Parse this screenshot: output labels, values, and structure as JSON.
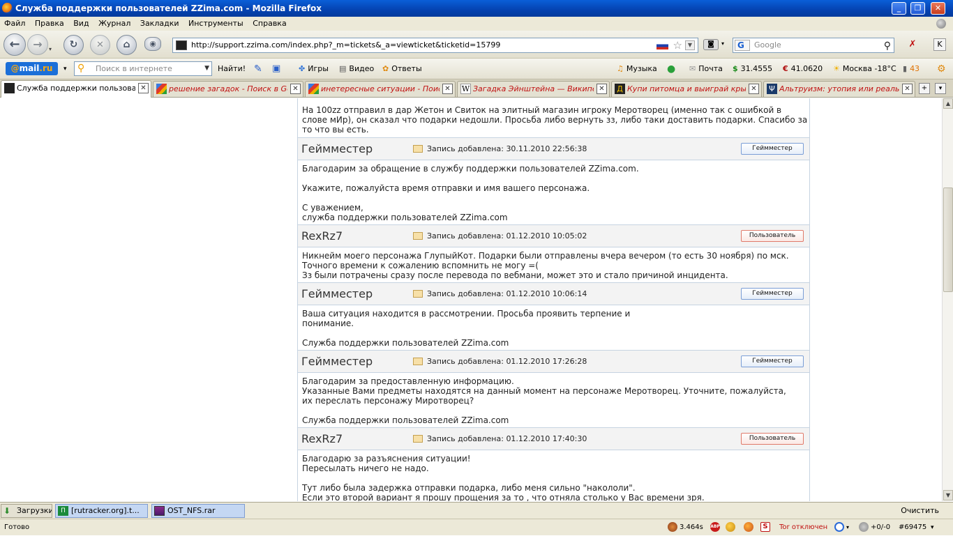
{
  "window": {
    "title": "Служба поддержки пользователей ZZima.com - Mozilla Firefox",
    "min_label": "_",
    "max_label": "❐",
    "close_label": "✕"
  },
  "menu": [
    "Файл",
    "Правка",
    "Вид",
    "Журнал",
    "Закладки",
    "Инструменты",
    "Справка"
  ],
  "nav": {
    "url": "http://support.zzima.com/index.php?_m=tickets&_a=viewticket&ticketid=15799",
    "search_placeholder": "Google",
    "search_engine_icon": "G"
  },
  "mailru": {
    "logo_prefix": "@",
    "logo_main": "mail",
    "logo_suffix": ".ru",
    "search_placeholder": "Поиск в интернете",
    "find_label": "Найти!",
    "games": "Игры",
    "video": "Видео",
    "answers": "Ответы",
    "music": "Музыка",
    "mail": "Почта",
    "usd": "31.4555",
    "eur": "41.0620",
    "weather": "Москва -18°C",
    "counter": "43"
  },
  "tabs": [
    {
      "label": "Служба поддержки пользоват...",
      "active": true
    },
    {
      "label": "решение загадок - Поиск в Goo...",
      "active": false
    },
    {
      "label": "инетересные ситуации - Поиск ...",
      "active": false
    },
    {
      "label": "Загадка Эйнштейна — Википед...",
      "active": false
    },
    {
      "label": "Купи питомца и выиграй крыль...",
      "active": false
    },
    {
      "label": "Альтруизм: утопия или реальн...",
      "active": false
    }
  ],
  "ticket": {
    "first_message": "На 100zz отправил в дар Жетон и Свиток на элитный магазин игроку Меротворец (именно так с ошибкой в слове мИр), он сказал что подарки недошли. Просьба либо вернуть зз, либо таки доставить подарки. Спасибо за то что вы есть.",
    "posts": [
      {
        "author": "Геймместер",
        "date": "Запись добавлена: 30.11.2010 22:56:38",
        "role": "Геймместер",
        "body": "Благодарим за обращение в службу поддержки пользователей ZZima.com.\n\nУкажите, пожалуйста время отправки и имя вашего персонажа.\n\nС уважением,\nслужба поддержки пользователей ZZima.com"
      },
      {
        "author": "RexRz7",
        "date": "Запись добавлена: 01.12.2010 10:05:02",
        "role": "Пользователь",
        "body": "Никнейм моего персонажа ГлупыйКот. Подарки были отправлены вчера вечером (то есть 30 ноября) по мск.\nТочного времени к сожалению вспомнить не могу =(\nЗз были потрачены сразу после перевода по вебмани, может это и стало причиной инцидента."
      },
      {
        "author": "Геймместер",
        "date": "Запись добавлена: 01.12.2010 10:06:14",
        "role": "Геймместер",
        "body": "Ваша ситуация находится в рассмотрении. Просьба проявить терпение и\nпонимание.\n\nСлужба поддержки пользователей ZZima.com"
      },
      {
        "author": "Геймместер",
        "date": "Запись добавлена: 01.12.2010 17:26:28",
        "role": "Геймместер",
        "body": "Благодарим за предоставленную информацию.\nУказанные Вами предметы находятся на данный момент на персонаже Меротворец. Уточните, пожалуйста,\nих переслать персонажу Миротворец?\n\nСлужба поддержки пользователей ZZima.com"
      },
      {
        "author": "RexRz7",
        "date": "Запись добавлена: 01.12.2010 17:40:30",
        "role": "Пользователь",
        "body": "Благодарю за разъяснения ситуации!\nПересылать ничего не надо.\n\nТут либо была задержка отправки подарка, либо меня сильно \"накололи\".\nЕсли это второй вариант я прошу прощения за то , что отняла столько у Вас времени зря."
      }
    ]
  },
  "downloads": {
    "button": "Загрузки",
    "items": [
      "[rutracker.org].t...",
      "OST_NFS.rar"
    ],
    "clear": "Очистить"
  },
  "status": {
    "text": "Готово",
    "speed": "3.464s",
    "tor": "Tor отключен",
    "counter": "+0/-0",
    "id": "#69475"
  }
}
